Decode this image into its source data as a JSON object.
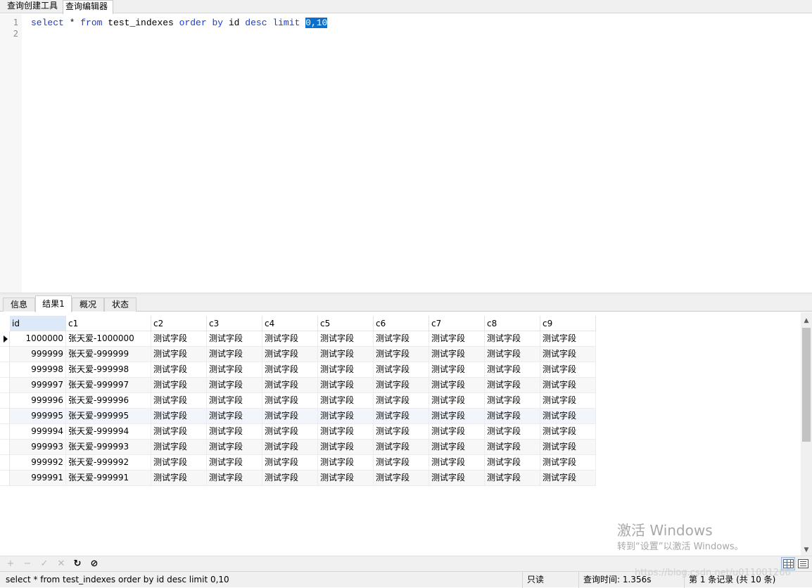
{
  "top_tabs": [
    "查询创建工具",
    "查询编辑器"
  ],
  "editor": {
    "line_numbers": [
      "1",
      "2"
    ],
    "sql": {
      "kw_select": "select",
      "star": " * ",
      "kw_from": "from",
      "table": " test_indexes ",
      "kw_order_by": "order by",
      "col": " id ",
      "kw_desc": "desc",
      "sp": " ",
      "kw_limit": "limit",
      "sp2": " ",
      "selected": "0,10"
    }
  },
  "result_tabs": [
    "信息",
    "结果1",
    "概况",
    "状态"
  ],
  "active_result_tab": "结果1",
  "grid": {
    "columns": [
      "id",
      "c1",
      "c2",
      "c3",
      "c4",
      "c5",
      "c6",
      "c7",
      "c8",
      "c9"
    ],
    "rows": [
      [
        "1000000",
        "张天爱-1000000",
        "测试字段",
        "测试字段",
        "测试字段",
        "测试字段",
        "测试字段",
        "测试字段",
        "测试字段",
        "测试字段"
      ],
      [
        "999999",
        "张天爱-999999",
        "测试字段",
        "测试字段",
        "测试字段",
        "测试字段",
        "测试字段",
        "测试字段",
        "测试字段",
        "测试字段"
      ],
      [
        "999998",
        "张天爱-999998",
        "测试字段",
        "测试字段",
        "测试字段",
        "测试字段",
        "测试字段",
        "测试字段",
        "测试字段",
        "测试字段"
      ],
      [
        "999997",
        "张天爱-999997",
        "测试字段",
        "测试字段",
        "测试字段",
        "测试字段",
        "测试字段",
        "测试字段",
        "测试字段",
        "测试字段"
      ],
      [
        "999996",
        "张天爱-999996",
        "测试字段",
        "测试字段",
        "测试字段",
        "测试字段",
        "测试字段",
        "测试字段",
        "测试字段",
        "测试字段"
      ],
      [
        "999995",
        "张天爱-999995",
        "测试字段",
        "测试字段",
        "测试字段",
        "测试字段",
        "测试字段",
        "测试字段",
        "测试字段",
        "测试字段"
      ],
      [
        "999994",
        "张天爱-999994",
        "测试字段",
        "测试字段",
        "测试字段",
        "测试字段",
        "测试字段",
        "测试字段",
        "测试字段",
        "测试字段"
      ],
      [
        "999993",
        "张天爱-999993",
        "测试字段",
        "测试字段",
        "测试字段",
        "测试字段",
        "测试字段",
        "测试字段",
        "测试字段",
        "测试字段"
      ],
      [
        "999992",
        "张天爱-999992",
        "测试字段",
        "测试字段",
        "测试字段",
        "测试字段",
        "测试字段",
        "测试字段",
        "测试字段",
        "测试字段"
      ],
      [
        "999991",
        "张天爱-999991",
        "测试字段",
        "测试字段",
        "测试字段",
        "测试字段",
        "测试字段",
        "测试字段",
        "测试字段",
        "测试字段"
      ]
    ]
  },
  "toolbar": {
    "add": "+",
    "delete": "−",
    "apply": "✓",
    "discard": "✕",
    "refresh": "↻",
    "stop": "⊘"
  },
  "watermark": {
    "line1": "激活 Windows",
    "line2": "转到“设置”以激活 Windows。",
    "url": "https://blog.csdn.net/u011001266"
  },
  "status": {
    "query": "select * from test_indexes order by id desc limit 0,10",
    "mode": "只读",
    "time": "查询时间: 1.356s",
    "records": "第 1 条记录 (共 10 条)"
  },
  "colors": {
    "keyword": "#1a3bd6",
    "selection": "#0a6fce",
    "active_header": "#dce9f8"
  }
}
